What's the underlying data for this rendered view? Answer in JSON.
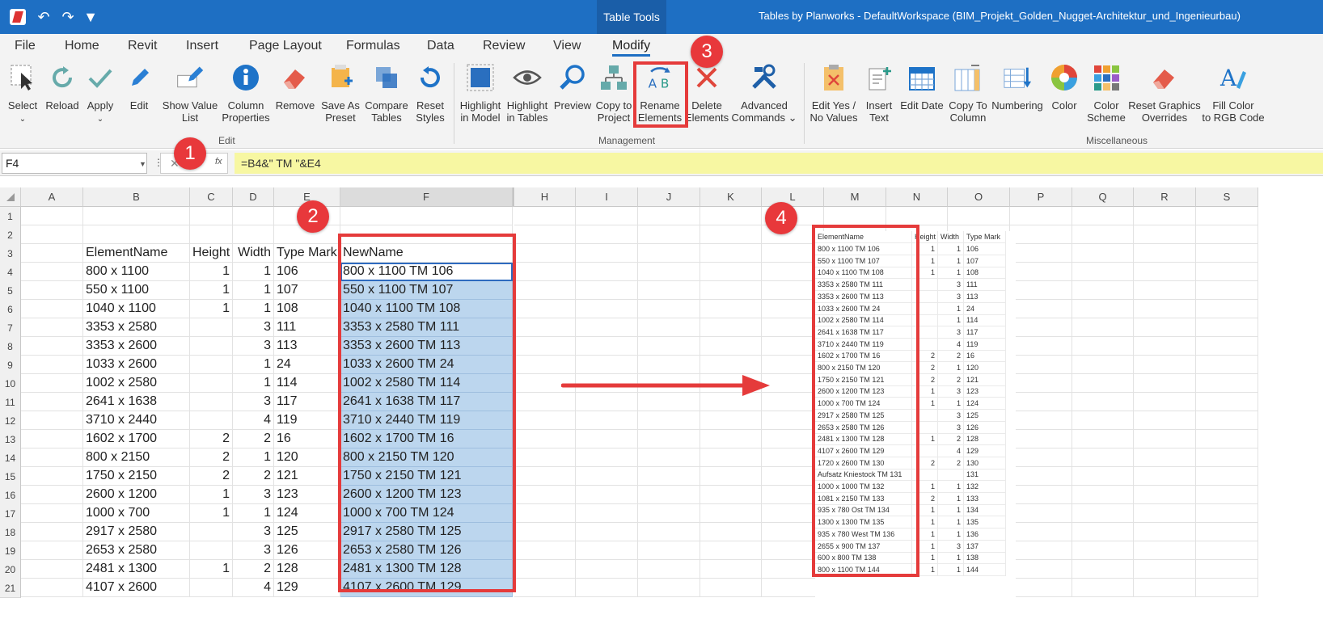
{
  "title_bar": {
    "context_tab": "Table Tools",
    "window_title": "Tables by Planworks - DefaultWorkspace  (BIM_Projekt_Golden_Nugget-Architektur_und_Ingenieurbau)"
  },
  "ribbon_tabs": [
    "File",
    "Home",
    "Revit",
    "Insert",
    "Page Layout",
    "Formulas",
    "Data",
    "Review",
    "View",
    "Modify"
  ],
  "ribbon": {
    "edit": {
      "label": "Edit",
      "buttons": [
        {
          "line1": "Select",
          "line2": "",
          "icon": "select-icon"
        },
        {
          "line1": "Reload",
          "line2": "",
          "icon": "reload-icon"
        },
        {
          "line1": "Apply",
          "line2": "",
          "icon": "apply-icon"
        },
        {
          "line1": "Edit",
          "line2": "",
          "icon": "edit-icon"
        },
        {
          "line1": "Show Value",
          "line2": "List",
          "icon": "show-value-list-icon"
        },
        {
          "line1": "Column",
          "line2": "Properties",
          "icon": "info-icon"
        },
        {
          "line1": "Remove",
          "line2": "",
          "icon": "eraser-icon"
        },
        {
          "line1": "Save As",
          "line2": "Preset",
          "icon": "save-preset-icon"
        },
        {
          "line1": "Compare",
          "line2": "Tables",
          "icon": "compare-icon"
        },
        {
          "line1": "Reset",
          "line2": "Styles",
          "icon": "reset-icon"
        }
      ]
    },
    "management": {
      "label": "Management",
      "buttons": [
        {
          "line1": "Highlight",
          "line2": "in Model",
          "icon": "highlight-model-icon"
        },
        {
          "line1": "Highlight",
          "line2": "in Tables",
          "icon": "eye-icon"
        },
        {
          "line1": "Preview",
          "line2": "",
          "icon": "magnifier-icon"
        },
        {
          "line1": "Copy to",
          "line2": "Project",
          "icon": "copy-project-icon"
        },
        {
          "line1": "Rename",
          "line2": "Elements",
          "icon": "rename-icon"
        },
        {
          "line1": "Delete",
          "line2": "Elements",
          "icon": "delete-icon"
        },
        {
          "line1": "Advanced",
          "line2": "Commands",
          "icon": "tools-icon"
        }
      ]
    },
    "misc": {
      "label": "Miscellaneous",
      "buttons": [
        {
          "line1": "Edit Yes /",
          "line2": "No Values",
          "icon": "clipboard-icon"
        },
        {
          "line1": "Insert",
          "line2": "Text",
          "icon": "insert-text-icon"
        },
        {
          "line1": "Edit Date",
          "line2": "",
          "icon": "calendar-icon"
        },
        {
          "line1": "Copy To",
          "line2": "Column",
          "icon": "copy-column-icon"
        },
        {
          "line1": "Numbering",
          "line2": "",
          "icon": "numbering-icon"
        },
        {
          "line1": "Color",
          "line2": "",
          "icon": "color-wheel-icon"
        },
        {
          "line1": "Color",
          "line2": "Scheme",
          "icon": "color-scheme-icon"
        },
        {
          "line1": "Reset Graphics",
          "line2": "Overrides",
          "icon": "eraser-icon"
        },
        {
          "line1": "Fill Color",
          "line2": "to RGB Code",
          "icon": "fill-color-icon"
        }
      ]
    }
  },
  "formula_bar": {
    "name_box": "F4",
    "formula": "=B4&\" TM \"&E4"
  },
  "columns": [
    "A",
    "B",
    "C",
    "D",
    "E",
    "F",
    "H",
    "I",
    "J",
    "K",
    "L",
    "M",
    "N",
    "O",
    "P",
    "Q",
    "R",
    "S"
  ],
  "rows": [
    {
      "n": "1",
      "b": "",
      "c": "",
      "d": "",
      "e": "",
      "f": ""
    },
    {
      "n": "2",
      "b": "",
      "c": "",
      "d": "",
      "e": "",
      "f": ""
    },
    {
      "n": "3",
      "b": "ElementName",
      "c": "Height",
      "d": "Width",
      "e": "Type Mark",
      "f": "NewName"
    },
    {
      "n": "4",
      "b": "800 x 1100",
      "c": "1",
      "d": "1",
      "e": "106",
      "f": "800 x 1100 TM 106"
    },
    {
      "n": "5",
      "b": "550 x 1100",
      "c": "1",
      "d": "1",
      "e": "107",
      "f": "550 x 1100 TM 107"
    },
    {
      "n": "6",
      "b": "1040 x 1100",
      "c": "1",
      "d": "1",
      "e": "108",
      "f": "1040 x 1100 TM 108"
    },
    {
      "n": "7",
      "b": "3353 x 2580",
      "c": "",
      "d": "3",
      "e": "111",
      "f": "3353 x 2580 TM 111"
    },
    {
      "n": "8",
      "b": "3353 x 2600",
      "c": "",
      "d": "3",
      "e": "113",
      "f": "3353 x 2600 TM 113"
    },
    {
      "n": "9",
      "b": "1033 x 2600",
      "c": "",
      "d": "1",
      "e": "24",
      "f": "1033 x 2600 TM 24"
    },
    {
      "n": "10",
      "b": "1002 x 2580",
      "c": "",
      "d": "1",
      "e": "114",
      "f": "1002 x 2580 TM 114"
    },
    {
      "n": "11",
      "b": "2641 x 1638",
      "c": "",
      "d": "3",
      "e": "117",
      "f": "2641 x 1638 TM 117"
    },
    {
      "n": "12",
      "b": "3710 x 2440",
      "c": "",
      "d": "4",
      "e": "119",
      "f": "3710 x 2440 TM 119"
    },
    {
      "n": "13",
      "b": "1602 x 1700",
      "c": "2",
      "d": "2",
      "e": "16",
      "f": "1602 x 1700 TM 16"
    },
    {
      "n": "14",
      "b": "800 x 2150",
      "c": "2",
      "d": "1",
      "e": "120",
      "f": "800 x 2150 TM 120"
    },
    {
      "n": "15",
      "b": "1750 x 2150",
      "c": "2",
      "d": "2",
      "e": "121",
      "f": "1750 x 2150 TM 121"
    },
    {
      "n": "16",
      "b": "2600 x 1200",
      "c": "1",
      "d": "3",
      "e": "123",
      "f": "2600 x 1200 TM 123"
    },
    {
      "n": "17",
      "b": "1000 x 700",
      "c": "1",
      "d": "1",
      "e": "124",
      "f": "1000 x 700 TM 124"
    },
    {
      "n": "18",
      "b": "2917 x 2580",
      "c": "",
      "d": "3",
      "e": "125",
      "f": "2917 x 2580 TM 125"
    },
    {
      "n": "19",
      "b": "2653 x 2580",
      "c": "",
      "d": "3",
      "e": "126",
      "f": "2653 x 2580 TM 126"
    },
    {
      "n": "20",
      "b": "2481 x 1300",
      "c": "1",
      "d": "2",
      "e": "128",
      "f": "2481 x 1300 TM 128"
    },
    {
      "n": "21",
      "b": "4107 x 2600",
      "c": "",
      "d": "4",
      "e": "129",
      "f": "4107 x 2600 TM 129"
    }
  ],
  "inset_table": {
    "headers": [
      "ElementName",
      "Height",
      "Width",
      "Type Mark"
    ],
    "rows": [
      [
        "800 x 1100 TM 106",
        "1",
        "1",
        "106"
      ],
      [
        "550 x 1100 TM 107",
        "1",
        "1",
        "107"
      ],
      [
        "1040 x 1100 TM 108",
        "1",
        "1",
        "108"
      ],
      [
        "3353 x 2580 TM 111",
        "",
        "3",
        "111"
      ],
      [
        "3353 x 2600 TM 113",
        "",
        "3",
        "113"
      ],
      [
        "1033 x 2600 TM 24",
        "",
        "1",
        "24"
      ],
      [
        "1002 x 2580 TM 114",
        "",
        "1",
        "114"
      ],
      [
        "2641 x 1638 TM 117",
        "",
        "3",
        "117"
      ],
      [
        "3710 x 2440 TM 119",
        "",
        "4",
        "119"
      ],
      [
        "1602 x 1700 TM 16",
        "2",
        "2",
        "16"
      ],
      [
        "800 x 2150 TM 120",
        "2",
        "1",
        "120"
      ],
      [
        "1750 x 2150 TM 121",
        "2",
        "2",
        "121"
      ],
      [
        "2600 x 1200 TM 123",
        "1",
        "3",
        "123"
      ],
      [
        "1000 x 700 TM 124",
        "1",
        "1",
        "124"
      ],
      [
        "2917 x 2580 TM 125",
        "",
        "3",
        "125"
      ],
      [
        "2653 x 2580 TM 126",
        "",
        "3",
        "126"
      ],
      [
        "2481 x 1300 TM 128",
        "1",
        "2",
        "128"
      ],
      [
        "4107 x 2600 TM 129",
        "",
        "4",
        "129"
      ],
      [
        "1720 x 2600 TM 130",
        "2",
        "2",
        "130"
      ],
      [
        "Aufsatz Kniestock TM 131",
        "",
        "",
        "131"
      ],
      [
        "1000 x 1000 TM 132",
        "1",
        "1",
        "132"
      ],
      [
        "1081 x 2150 TM 133",
        "2",
        "1",
        "133"
      ],
      [
        "935 x 780 Ost TM 134",
        "1",
        "1",
        "134"
      ],
      [
        "1300 x 1300 TM 135",
        "1",
        "1",
        "135"
      ],
      [
        "935 x 780 West TM 136",
        "1",
        "1",
        "136"
      ],
      [
        "2655 x 900 TM 137",
        "1",
        "3",
        "137"
      ],
      [
        "600 x 800 TM 138",
        "1",
        "1",
        "138"
      ],
      [
        "800 x 1100 TM 144",
        "1",
        "1",
        "144"
      ]
    ]
  },
  "annotations": {
    "b1": "1",
    "b2": "2",
    "b3": "3",
    "b4": "4"
  },
  "colors": {
    "accent": "#1e6fc3",
    "highlight": "#bcd6ee",
    "annotation": "#e53b3b",
    "formula_bg": "#f7f7a2"
  }
}
